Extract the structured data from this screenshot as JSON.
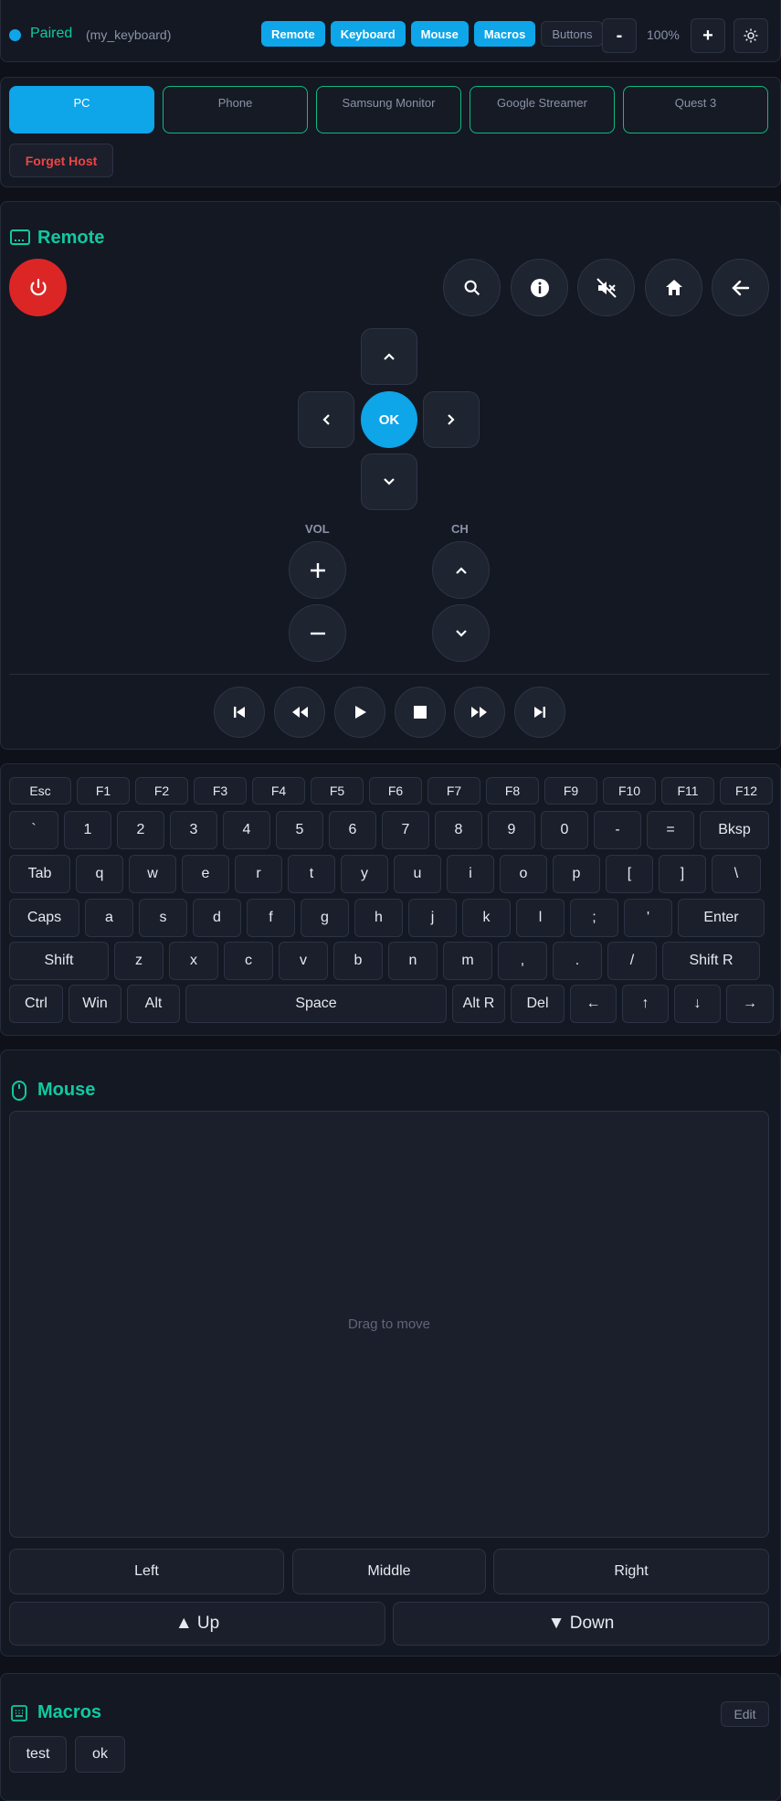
{
  "status": {
    "label": "Paired",
    "device": "(my_keyboard)",
    "dot_color": "#0ea5e9"
  },
  "toolbar": {
    "tabs": [
      {
        "label": "Remote",
        "active": true
      },
      {
        "label": "Keyboard",
        "active": true
      },
      {
        "label": "Mouse",
        "active": true
      },
      {
        "label": "Macros",
        "active": true
      },
      {
        "label": "Buttons",
        "active": false
      }
    ],
    "zoom_minus": "-",
    "zoom_value": "100%",
    "zoom_plus": "+",
    "theme_icon": "sun-icon"
  },
  "hosts": {
    "items": [
      {
        "label": "PC",
        "active": true
      },
      {
        "label": "Phone",
        "active": false
      },
      {
        "label": "Samsung Monitor",
        "active": false
      },
      {
        "label": "Google Streamer",
        "active": false
      },
      {
        "label": "Quest 3",
        "active": false
      }
    ],
    "forget_label": "Forget Host"
  },
  "remote": {
    "title": "Remote",
    "icon": "tv-icon",
    "power_icon": "power-icon",
    "top_buttons": [
      "search-icon",
      "info-icon",
      "mute-icon",
      "home-icon",
      "back-arrow-icon"
    ],
    "ok_label": "OK",
    "vol_label": "VOL",
    "ch_label": "CH",
    "media_buttons": [
      "previous-icon",
      "rewind-icon",
      "play-icon",
      "stop-icon",
      "fast-forward-icon",
      "next-icon"
    ]
  },
  "keyboard": {
    "fkeys": [
      "Esc",
      "F1",
      "F2",
      "F3",
      "F4",
      "F5",
      "F6",
      "F7",
      "F8",
      "F9",
      "F10",
      "F11",
      "F12"
    ],
    "row1": [
      "`",
      "1",
      "2",
      "3",
      "4",
      "5",
      "6",
      "7",
      "8",
      "9",
      "0",
      "-",
      "=",
      "Bksp"
    ],
    "row2": [
      "Tab",
      "q",
      "w",
      "e",
      "r",
      "t",
      "y",
      "u",
      "i",
      "o",
      "p",
      "[",
      "]",
      "\\"
    ],
    "row3": [
      "Caps",
      "a",
      "s",
      "d",
      "f",
      "g",
      "h",
      "j",
      "k",
      "l",
      ";",
      "'",
      "Enter"
    ],
    "row4": [
      "Shift",
      "z",
      "x",
      "c",
      "v",
      "b",
      "n",
      "m",
      ",",
      ".",
      "/",
      "Shift R"
    ],
    "row5": [
      "Ctrl",
      "Win",
      "Alt",
      "Space",
      "Alt R",
      "Del",
      "←",
      "↑",
      "↓",
      "→"
    ]
  },
  "mouse": {
    "title": "Mouse",
    "icon": "mouse-icon",
    "pad_hint": "Drag to move",
    "left": "Left",
    "middle": "Middle",
    "right": "Right",
    "up": "▲ Up",
    "down": "▼ Down"
  },
  "macros": {
    "title": "Macros",
    "icon": "keypad-icon",
    "edit_label": "Edit",
    "items": [
      "test",
      "ok"
    ]
  }
}
